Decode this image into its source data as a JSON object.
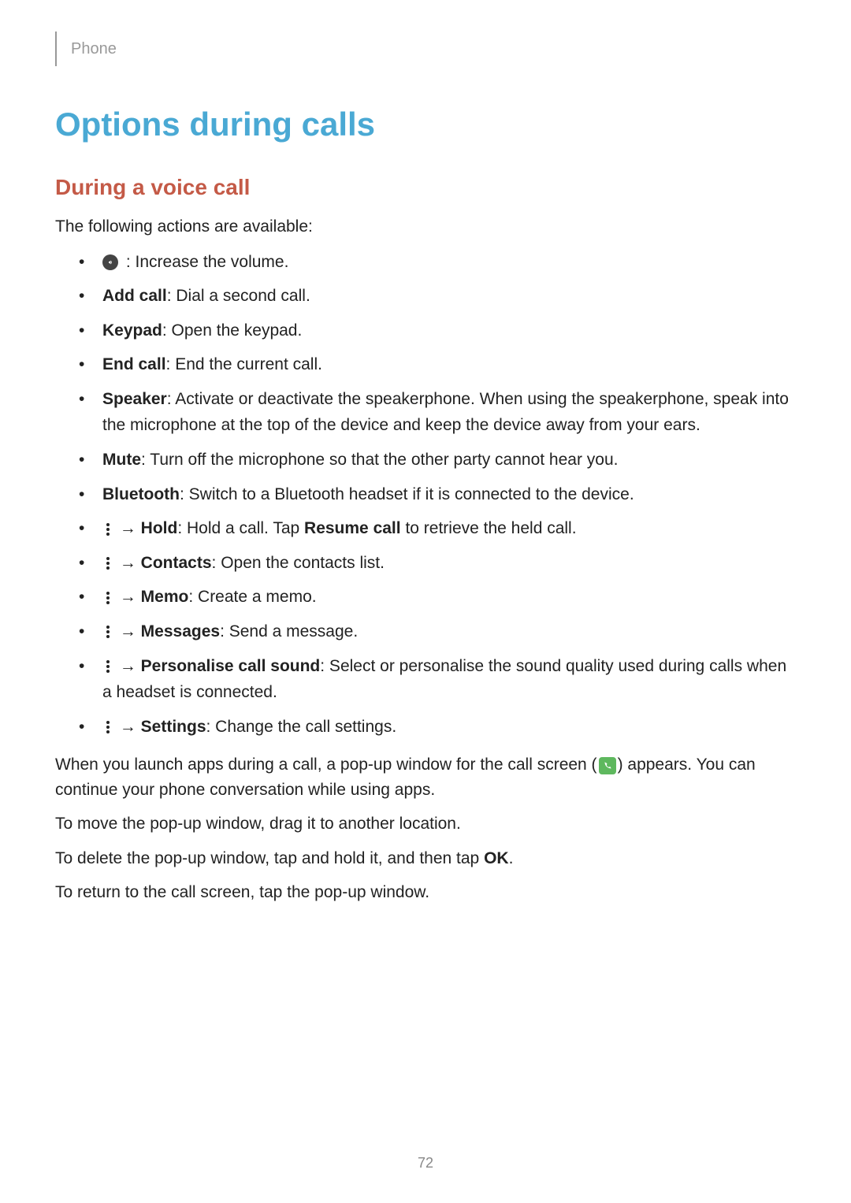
{
  "header": {
    "label": "Phone"
  },
  "title": "Options during calls",
  "subtitle": "During a voice call",
  "intro": "The following actions are available:",
  "bullets": {
    "volume": " : Increase the volume.",
    "addcall_label": "Add call",
    "addcall_desc": ": Dial a second call.",
    "keypad_label": "Keypad",
    "keypad_desc": ": Open the keypad.",
    "endcall_label": "End call",
    "endcall_desc": ": End the current call.",
    "speaker_label": "Speaker",
    "speaker_desc": ": Activate or deactivate the speakerphone. When using the speakerphone, speak into the microphone at the top of the device and keep the device away from your ears.",
    "mute_label": "Mute",
    "mute_desc": ": Turn off the microphone so that the other party cannot hear you.",
    "bluetooth_label": "Bluetooth",
    "bluetooth_desc": ": Switch to a Bluetooth headset if it is connected to the device.",
    "arrow": " → ",
    "hold_label": "Hold",
    "hold_desc_a": ": Hold a call. Tap ",
    "hold_resume": "Resume call",
    "hold_desc_b": " to retrieve the held call.",
    "contacts_label": "Contacts",
    "contacts_desc": ": Open the contacts list.",
    "memo_label": "Memo",
    "memo_desc": ": Create a memo.",
    "messages_label": "Messages",
    "messages_desc": ": Send a message.",
    "personalise_label": "Personalise call sound",
    "personalise_desc": ": Select or personalise the sound quality used during calls when a headset is connected.",
    "settings_label": "Settings",
    "settings_desc": ": Change the call settings."
  },
  "paragraphs": {
    "popup_a": "When you launch apps during a call, a pop-up window for the call screen (",
    "popup_b": ") appears. You can continue your phone conversation while using apps.",
    "move": "To move the pop-up window, drag it to another location.",
    "delete_a": "To delete the pop-up window, tap and hold it, and then tap ",
    "delete_ok": "OK",
    "delete_b": ".",
    "return": "To return to the call screen, tap the pop-up window."
  },
  "page_number": "72"
}
